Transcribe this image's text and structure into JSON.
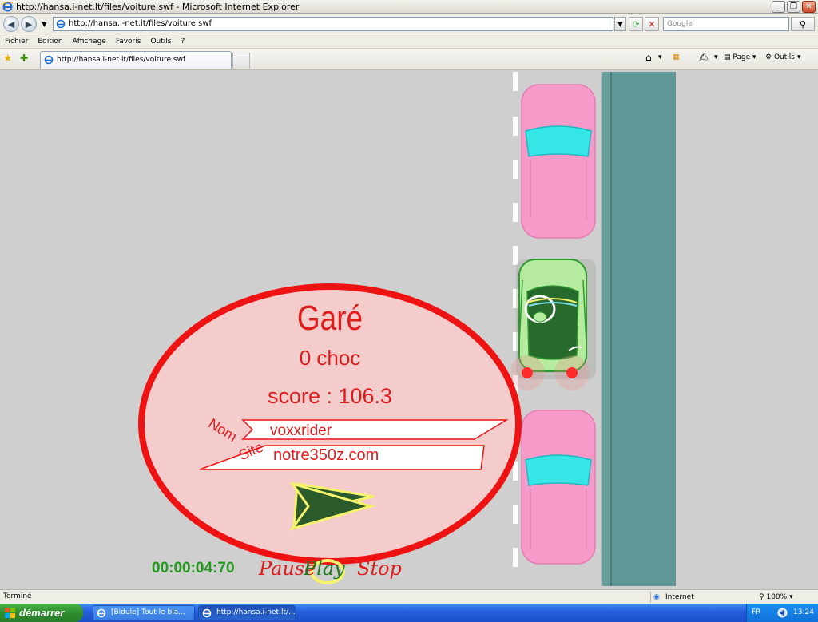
{
  "window": {
    "title": "http://hansa.i-net.lt/files/voiture.swf - Microsoft Internet Explorer",
    "minimize": "_",
    "maximize": "❐",
    "close": "✕"
  },
  "address_bar": {
    "url": "http://hansa.i-net.lt/files/voiture.swf",
    "search_placeholder": "Google"
  },
  "menu": [
    "Fichier",
    "Edition",
    "Affichage",
    "Favoris",
    "Outils",
    "?"
  ],
  "tab": {
    "label": "http://hansa.i-net.lt/files/voiture.swf"
  },
  "commands": {
    "page": "Page",
    "tools": "Outils"
  },
  "game": {
    "result_title": "Garé",
    "collisions": "0 choc",
    "score": "score : 106.3",
    "name_label": "Nom",
    "name_value": "voxxrider",
    "site_label": "Site",
    "site_value": "notre350z.com",
    "timer": "00:00:04:70",
    "controls": {
      "pause": "Pause",
      "play": "Play",
      "stop": "Stop"
    },
    "colors": {
      "text_red": "#e01b1b",
      "panel_fill": "#f5cccc",
      "timer_green": "#239a1e",
      "road": "#cfcfcf",
      "sidewalk": "#5f9896",
      "pink_car": "#f59ac9",
      "green_car": "#b6eba0"
    }
  },
  "status_bar": {
    "status": "Terminé",
    "zone": "Internet",
    "zoom": "100%"
  },
  "taskbar": {
    "start": "démarrer",
    "items": [
      "[Bidule] Tout le bla...",
      "http://hansa.i-net.lt/..."
    ],
    "language": "FR",
    "clock": "13:24"
  }
}
